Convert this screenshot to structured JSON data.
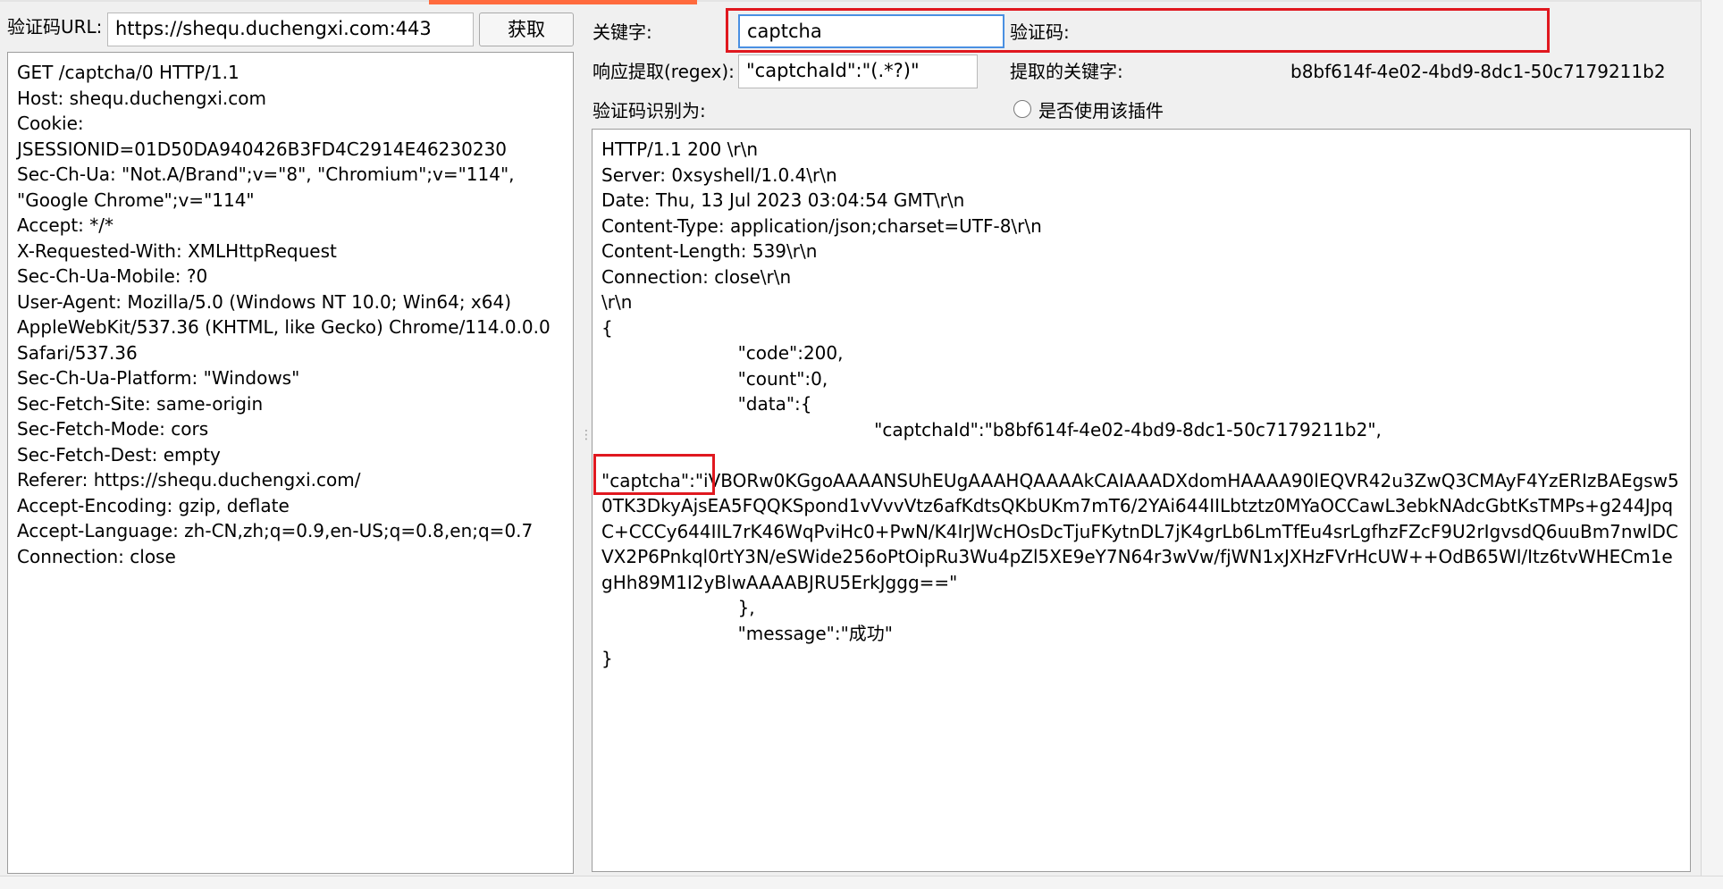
{
  "left": {
    "url_label": "验证码URL:",
    "url_value": "https://shequ.duchengxi.com:443",
    "fetch_button": "获取",
    "request_text": "GET /captcha/0 HTTP/1.1\nHost: shequ.duchengxi.com\nCookie:\nJSESSIONID=01D50DA940426B3FD4C2914E46230230\nSec-Ch-Ua: \"Not.A/Brand\";v=\"8\", \"Chromium\";v=\"114\",\n\"Google Chrome\";v=\"114\"\nAccept: */*\nX-Requested-With: XMLHttpRequest\nSec-Ch-Ua-Mobile: ?0\nUser-Agent: Mozilla/5.0 (Windows NT 10.0; Win64; x64)\nAppleWebKit/537.36 (KHTML, like Gecko) Chrome/114.0.0.0\nSafari/537.36\nSec-Ch-Ua-Platform: \"Windows\"\nSec-Fetch-Site: same-origin\nSec-Fetch-Mode: cors\nSec-Fetch-Dest: empty\nReferer: https://shequ.duchengxi.com/\nAccept-Encoding: gzip, deflate\nAccept-Language: zh-CN,zh;q=0.9,en-US;q=0.8,en;q=0.7\nConnection: close"
  },
  "right": {
    "keyword_label": "关键字:",
    "keyword_value": "captcha",
    "captcha_label": "验证码:",
    "regex_label": "响应提取(regex):",
    "regex_value": "\"captchaId\":\"(.*?)\"",
    "extracted_label": "提取的关键字:",
    "extracted_value": "b8bf614f-4e02-4bd9-8dc1-50c7179211b2",
    "recognized_label": "验证码识别为:",
    "plugin_label": "是否使用该插件",
    "response_text": "HTTP/1.1 200 \\r\\n\nServer: 0xsyshell/1.0.4\\r\\n\nDate: Thu, 13 Jul 2023 03:04:54 GMT\\r\\n\nContent-Type: application/json;charset=UTF-8\\r\\n\nContent-Length: 539\\r\\n\nConnection: close\\r\\n\n\\r\\n\n{\n\t\t\t\"code\":200,\n\t\t\t\"count\":0,\n\t\t\t\"data\":{\n\t\t\t\t\t\t\"captchaId\":\"b8bf614f-4e02-4bd9-8dc1-50c7179211b2\",\n\n\"captcha\":\"iVBORw0KGgoAAAANSUhEUgAAAHQAAAAkCAIAAADXdomHAAAA90lEQVR42u3ZwQ3CMAyF4YzERIzBAEgsw50TK3DkyAjsEA5FQQKSpond1vVvvVtz6afKdtsQKbUKm7mT6/2YAi644IILbtztz0MYaOCCawL3ebkNAdcGbtKsTMPs+g244JpqC+CCCy644IIL7rK46WqPviHc0+PwN/K4IrJWcHOsDcTjuFKytnDL7jK4grLb6LmTfEu4srLgfhzFZcF9U2rIgvsdQ6uuBm7nwlDCVX2P6Pnkql0rtY3N/eSWide256oPtOipRu3Wu4pZl5XE9eY7N64r3wVw/fjWN1xJXHzFVrHcUW++OdB65Wl/Itz6tvWHECm1egHh89M1I2yBlwAAAABJRU5ErkJggg==\"\n\t\t\t},\n\t\t\t\"message\":\"成功\"\n}"
  }
}
